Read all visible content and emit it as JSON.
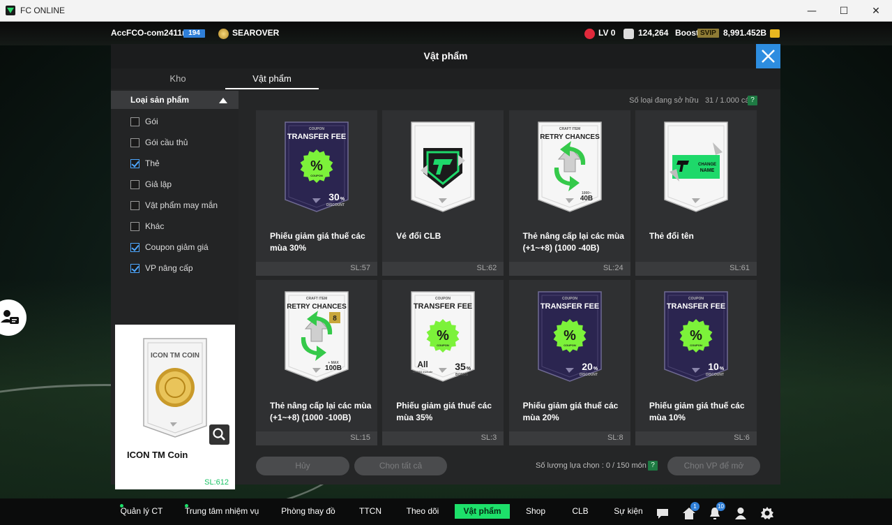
{
  "window": {
    "title": "FC ONLINE",
    "controls": {
      "minimize": "—",
      "maximize": "☐",
      "close": "✕"
    }
  },
  "topbar": {
    "account": "AccFCO-com2411m",
    "level": "194",
    "team": "SEAROVER",
    "lv": "LV 0",
    "points": "124,264",
    "boost_label": "Boost",
    "svip": "SVIP",
    "bp": "8,991.452B"
  },
  "modal": {
    "title": "Vật phẩm",
    "tabs": [
      {
        "label": "Kho"
      },
      {
        "label": "Vật phẩm"
      }
    ],
    "filter_header": "Loại sản phẩm",
    "filters": [
      {
        "label": "Gói",
        "checked": false
      },
      {
        "label": "Gói cầu thủ",
        "checked": false
      },
      {
        "label": "Thẻ",
        "checked": true
      },
      {
        "label": "Giả lập",
        "checked": false
      },
      {
        "label": "Vật phẩm may mắn",
        "checked": false
      },
      {
        "label": "Khác",
        "checked": false
      },
      {
        "label": "Coupon giảm giá",
        "checked": true
      },
      {
        "label": "VP nâng cấp",
        "checked": true
      }
    ],
    "owned_label": "Số loại đang sở hữu",
    "owned_value": "31 / 1.000 cái",
    "help": "?",
    "detail": {
      "card_title": "ICON TM COIN",
      "name": "ICON TM Coin",
      "qty": "SL:612"
    },
    "items": [
      {
        "name": "Phiếu giảm giá thuế các mùa 30%",
        "qty": "SL:57",
        "kind": "coupon",
        "dark": true,
        "top": "COUPON",
        "head": "TRANSFER FEE",
        "value": "30",
        "unit": "%",
        "sub": "DISCOUNT"
      },
      {
        "name": "Vé đổi CLB",
        "qty": "SL:62",
        "kind": "club",
        "dark": false
      },
      {
        "name": "Thẻ nâng cấp lại các mùa (+1~+8) (1000 -40B)",
        "qty": "SL:24",
        "kind": "retry",
        "dark": false,
        "top": "CRAFT ITEM",
        "head": "RETRY CHANCES",
        "value": "40B",
        "unit": "",
        "sub": "1000~"
      },
      {
        "name": "Thẻ đổi tên",
        "qty": "SL:61",
        "kind": "rename",
        "dark": false,
        "label1": "CHANGE",
        "label2": "NAME"
      },
      {
        "name": "Thẻ nâng cấp lại các mùa (+1~+8) (1000 -100B)",
        "qty": "SL:15",
        "kind": "retry",
        "dark": false,
        "top": "CRAFT ITEM",
        "head": "RETRY CHANCES",
        "value": "100B",
        "unit": "",
        "sub": "+ MAX",
        "badge": "8"
      },
      {
        "name": "Phiếu giảm giá thuế các mùa 35%",
        "qty": "SL:3",
        "kind": "coupon",
        "dark": false,
        "top": "COUPON",
        "head": "TRANSFER FEE",
        "value": "35",
        "unit": "%",
        "sub": "BONUS",
        "extra": "All",
        "extra_sub": "CLASS Include"
      },
      {
        "name": "Phiếu giảm giá thuế các mùa 20%",
        "qty": "SL:8",
        "kind": "coupon",
        "dark": true,
        "top": "COUPON",
        "head": "TRANSFER FEE",
        "value": "20",
        "unit": "%",
        "sub": "DISCOUNT"
      },
      {
        "name": "Phiếu giảm giá thuế các mùa 10%",
        "qty": "SL:6",
        "kind": "coupon",
        "dark": true,
        "top": "COUPON",
        "head": "TRANSFER FEE",
        "value": "10",
        "unit": "%",
        "sub": "DISCOUNT"
      }
    ],
    "buttons": {
      "cancel": "Hủy",
      "select_all": "Chọn tất cả",
      "open": "Chọn VP để mở"
    },
    "selection_label": "Số lượng lựa chọn : 0 / 150 món",
    "percent_glyph": "%",
    "coupon_word": "COUPON"
  },
  "bottom_nav": [
    {
      "label": "Quản lý CT",
      "dot": true
    },
    {
      "label": "Trung tâm nhiệm vụ",
      "dot": true
    },
    {
      "label": "Phòng thay đồ",
      "dot": false
    },
    {
      "label": "TTCN",
      "dot": false
    },
    {
      "label": "Theo dõi",
      "dot": false
    },
    {
      "label": "Vật phẩm",
      "dot": false,
      "active": true
    },
    {
      "label": "Shop",
      "dot": false
    },
    {
      "label": "CLB",
      "dot": false
    },
    {
      "label": "Sự kiện",
      "dot": false
    }
  ],
  "bottom_icons": [
    {
      "name": "chat-icon"
    },
    {
      "name": "home-icon",
      "badge": "1"
    },
    {
      "name": "bell-icon",
      "badge": "10"
    },
    {
      "name": "profile-icon"
    },
    {
      "name": "settings-icon"
    }
  ],
  "colors": {
    "accent_green": "#1de06a",
    "accent_blue": "#2d8de0",
    "coupon_dark": "#2b2550",
    "coupon_green": "#7cf23a"
  }
}
